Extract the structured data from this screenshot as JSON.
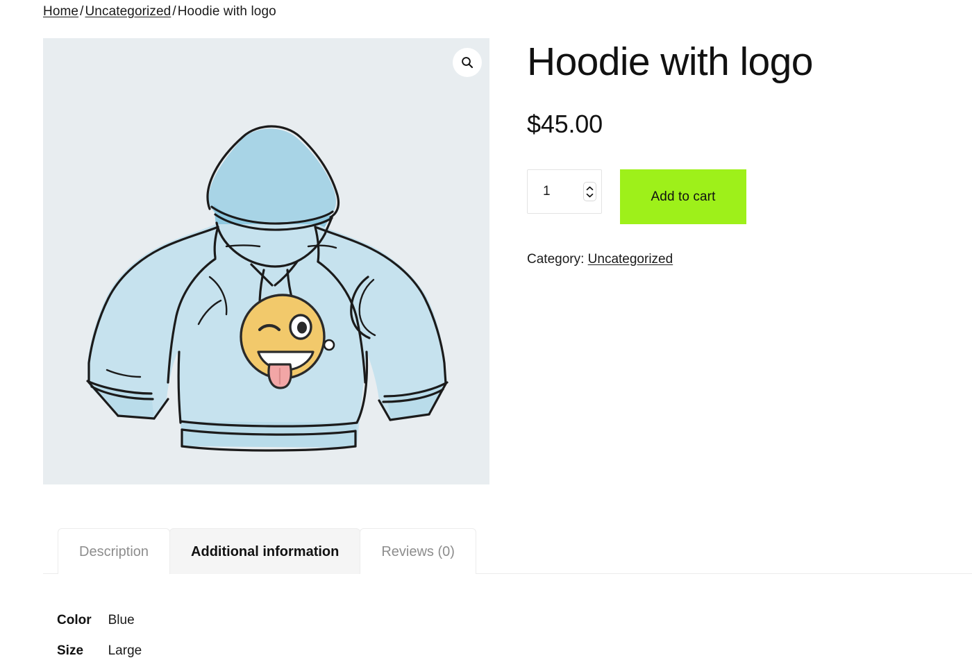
{
  "breadcrumb": {
    "items": [
      {
        "label": "Home",
        "link": true
      },
      {
        "label": "Uncategorized",
        "link": true
      },
      {
        "label": "Hoodie with logo",
        "link": false
      }
    ],
    "separator": "/"
  },
  "gallery": {
    "zoom_icon": "magnifier-icon",
    "background_color": "#e8edf0",
    "product_image_alt": "Hoodie with logo",
    "hoodie_fill": "#c6e2ee",
    "hoodie_shade": "#a8d4e6",
    "outline_color": "#1b1b1b",
    "emoji_face": "#f2c96b",
    "emoji_tongue": "#f2a6a6"
  },
  "product": {
    "title": "Hoodie with logo",
    "price": "$45.00",
    "quantity_value": "1",
    "quantity_placeholder": "1",
    "add_to_cart_label": "Add to cart",
    "add_to_cart_color": "#9ef01a",
    "category_prefix": "Category:",
    "category_name": "Uncategorized"
  },
  "tabs": [
    {
      "label": "Description",
      "active": false
    },
    {
      "label": "Additional information",
      "active": true
    },
    {
      "label": "Reviews (0)",
      "active": false
    }
  ],
  "attributes": {
    "rows": [
      {
        "name": "Color",
        "value": "Blue"
      },
      {
        "name": "Size",
        "value": "Large"
      }
    ]
  }
}
